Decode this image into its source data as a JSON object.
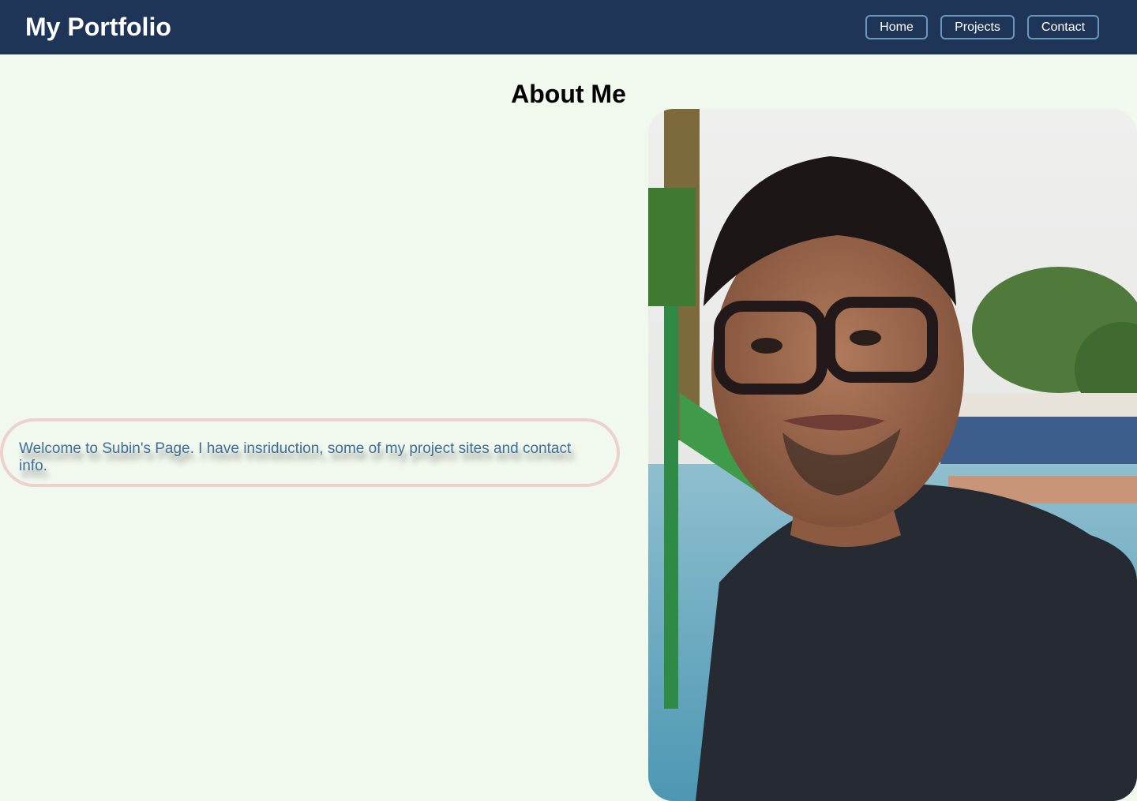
{
  "header": {
    "title": "My Portfolio",
    "nav": {
      "home": "Home",
      "projects": "Projects",
      "contact": "Contact"
    }
  },
  "main": {
    "title": "About Me",
    "welcome_text": "Welcome to Subin's Page. I have insriduction, some of my project sites and contact info."
  },
  "colors": {
    "header_bg": "#1e3557",
    "page_bg": "#f1f8ee",
    "nav_border": "#6699bb",
    "welcome_border": "#ecd1cf",
    "welcome_text": "#3f6f96"
  },
  "icons": {
    "profile_photo": "profile-photo"
  }
}
